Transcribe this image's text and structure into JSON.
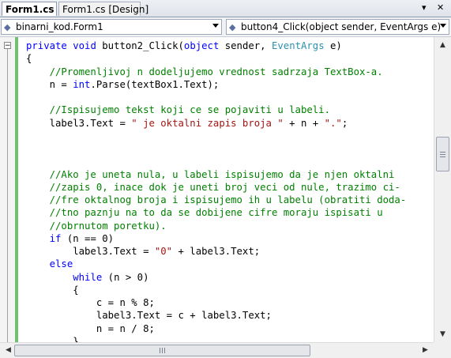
{
  "tabs": [
    {
      "label": "Form1.cs",
      "active": true
    },
    {
      "label": "Form1.cs [Design]",
      "active": false
    }
  ],
  "tab_controls": {
    "dropdown_icon": "chevron-down-icon",
    "close_icon": "close-icon",
    "close_glyph": "✕",
    "dropdown_glyph": "▾"
  },
  "nav": {
    "type_combo": {
      "value": "binarni_kod.Form1",
      "icon": "class-icon"
    },
    "member_combo": {
      "value": "button4_Click(object sender, EventArgs e)",
      "icon": "method-icon"
    }
  },
  "editor": {
    "collapse_glyph": "−",
    "lines": [
      [
        [
          "kw",
          "private void"
        ],
        [
          "",
          "button2_Click("
        ],
        [
          "kw",
          "object"
        ],
        [
          "",
          ""
        ],
        [
          "",
          ""
        ],
        [
          "",
          ""
        ],
        [
          "",
          ""
        ],
        [
          "",
          ""
        ],
        [
          "",
          ""
        ]
      ],
      [],
      [],
      [],
      [],
      [],
      [],
      [],
      [],
      [],
      [],
      [],
      [],
      [],
      [],
      [],
      [],
      [],
      [],
      [],
      [],
      [],
      [],
      [],
      []
    ],
    "code": [
      [
        {
          "c": "kw",
          "t": "private"
        },
        {
          "c": "",
          "t": " "
        },
        {
          "c": "kw",
          "t": "void"
        },
        {
          "c": "",
          "t": " button2_Click("
        },
        {
          "c": "kw",
          "t": "object"
        },
        {
          "c": "",
          "t": " sender, "
        },
        {
          "c": "ty",
          "t": "EventArgs"
        },
        {
          "c": "",
          "t": " e)"
        }
      ],
      [
        {
          "c": "",
          "t": "{"
        }
      ],
      [
        {
          "c": "cm",
          "t": "    //Promenljivoj n dodeljujemo vrednost sadrzaja TextBox-a."
        }
      ],
      [
        {
          "c": "",
          "t": "    n = "
        },
        {
          "c": "kw",
          "t": "int"
        },
        {
          "c": "",
          "t": ".Parse(textBox1.Text);"
        }
      ],
      [
        {
          "c": "",
          "t": ""
        }
      ],
      [
        {
          "c": "cm",
          "t": "    //Ispisujemo tekst koji ce se pojaviti u labeli."
        }
      ],
      [
        {
          "c": "",
          "t": "    label3.Text = "
        },
        {
          "c": "st",
          "t": "\" je oktalni zapis broja \""
        },
        {
          "c": "",
          "t": " + n + "
        },
        {
          "c": "st",
          "t": "\".\""
        },
        {
          "c": "",
          "t": ";"
        }
      ],
      [
        {
          "c": "",
          "t": ""
        }
      ],
      [
        {
          "c": "",
          "t": ""
        }
      ],
      [
        {
          "c": "",
          "t": ""
        }
      ],
      [
        {
          "c": "cm",
          "t": "    //Ako je uneta nula, u labeli ispisujemo da je njen oktalni"
        }
      ],
      [
        {
          "c": "cm",
          "t": "    //zapis 0, inace dok je uneti broj veci od nule, trazimo ci-"
        }
      ],
      [
        {
          "c": "cm",
          "t": "    //fre oktalnog broja i ispisujemo ih u labelu (obratiti doda-"
        }
      ],
      [
        {
          "c": "cm",
          "t": "    //tno paznju na to da se dobijene cifre moraju ispisati u"
        }
      ],
      [
        {
          "c": "cm",
          "t": "    //obrnutom poretku)."
        }
      ],
      [
        {
          "c": "",
          "t": "    "
        },
        {
          "c": "kw",
          "t": "if"
        },
        {
          "c": "",
          "t": " (n == 0)"
        }
      ],
      [
        {
          "c": "",
          "t": "        label3.Text = "
        },
        {
          "c": "st",
          "t": "\"0\""
        },
        {
          "c": "",
          "t": " + label3.Text;"
        }
      ],
      [
        {
          "c": "",
          "t": "    "
        },
        {
          "c": "kw",
          "t": "else"
        }
      ],
      [
        {
          "c": "",
          "t": "        "
        },
        {
          "c": "kw",
          "t": "while"
        },
        {
          "c": "",
          "t": " (n > 0)"
        }
      ],
      [
        {
          "c": "",
          "t": "        {"
        }
      ],
      [
        {
          "c": "",
          "t": "            c = n % 8;"
        }
      ],
      [
        {
          "c": "",
          "t": "            label3.Text = c + label3.Text;"
        }
      ],
      [
        {
          "c": "",
          "t": "            n = n / 8;"
        }
      ],
      [
        {
          "c": "",
          "t": "        }"
        }
      ]
    ]
  },
  "scrollbars": {
    "up_glyph": "▲",
    "down_glyph": "▼",
    "left_glyph": "◀",
    "right_glyph": "▶"
  },
  "colors": {
    "keyword": "#0000ff",
    "type": "#2b91af",
    "comment": "#008000",
    "string": "#a31515",
    "change_marker": "#6ac36a"
  }
}
